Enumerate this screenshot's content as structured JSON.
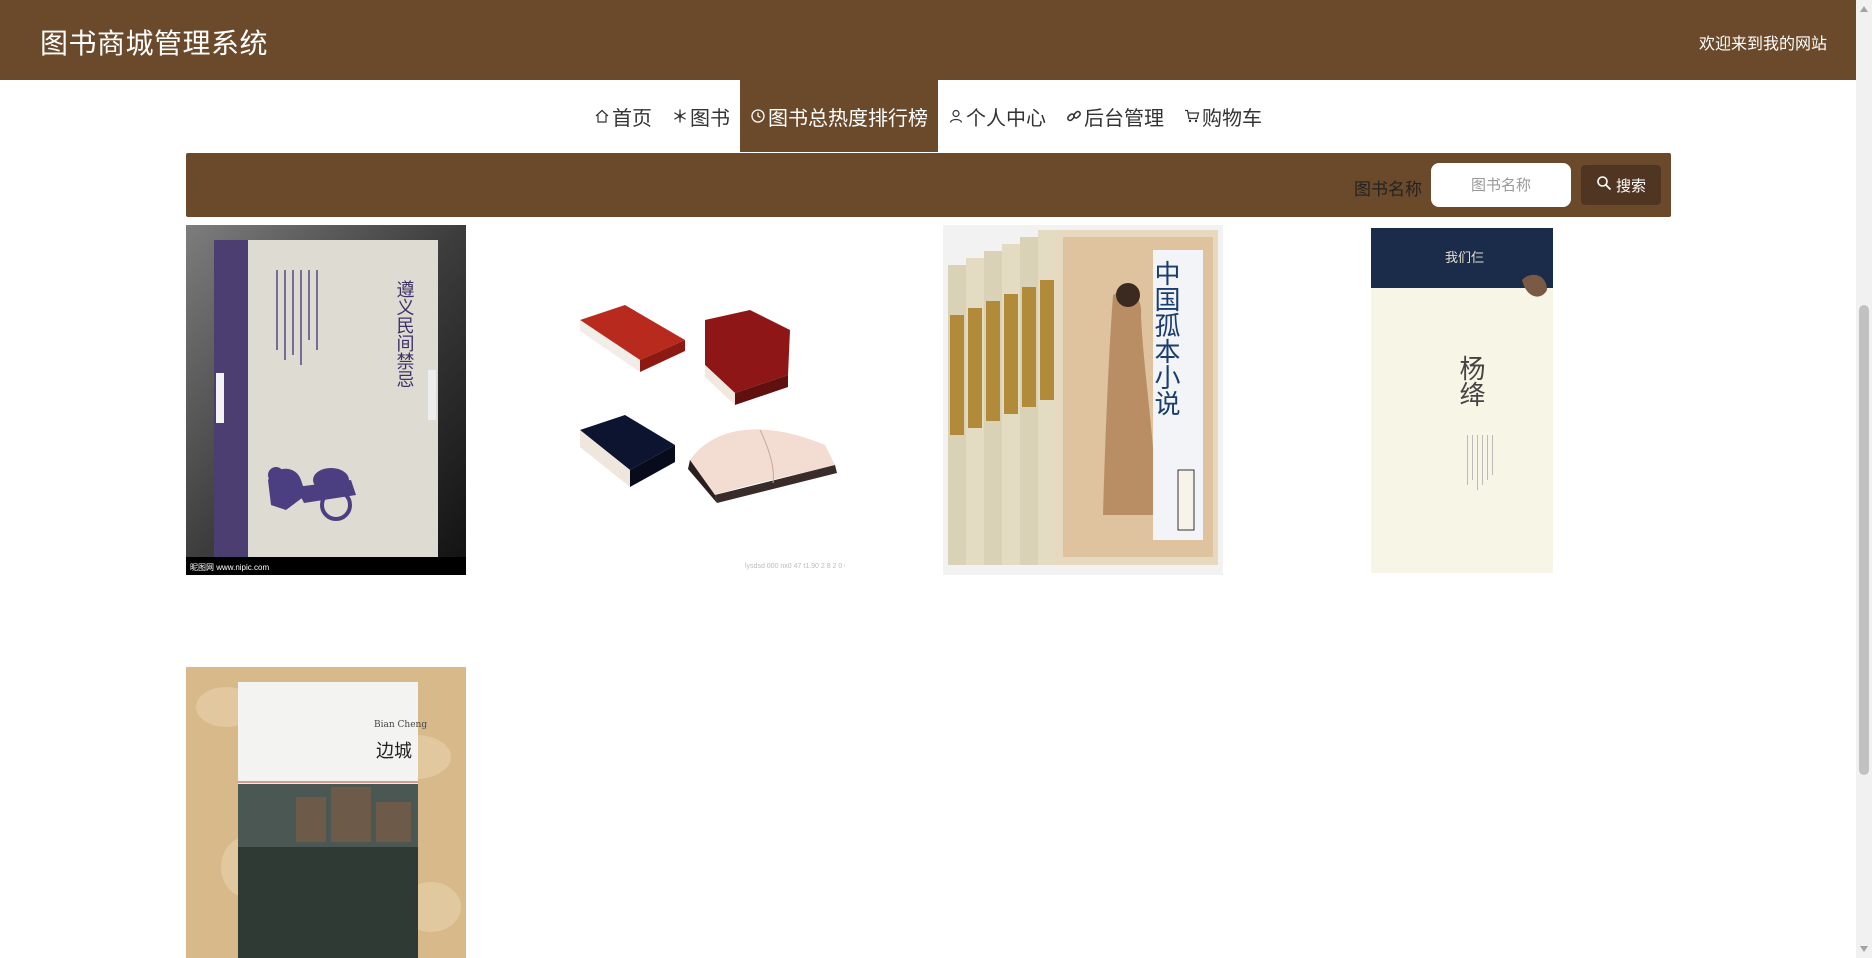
{
  "header": {
    "title": "图书商城管理系统",
    "welcome": "欢迎来到我的网站"
  },
  "nav": {
    "items": [
      {
        "label": "首页",
        "icon": "home-icon"
      },
      {
        "label": "图书",
        "icon": "snowflake-icon"
      },
      {
        "label": "图书总热度排行榜",
        "icon": "clock-icon",
        "active": true
      },
      {
        "label": "个人中心",
        "icon": "user-icon"
      },
      {
        "label": "后台管理",
        "icon": "link-icon"
      },
      {
        "label": "购物车",
        "icon": "cart-icon"
      }
    ]
  },
  "search": {
    "label": "图书名称",
    "placeholder": "图书名称",
    "button_label": "搜索",
    "button_icon": "search-icon"
  },
  "books": [
    {
      "cover_title": "遵义民间禁忌",
      "watermark_left": "昵图网 www.nipic.com"
    },
    {
      "cover_title": "",
      "watermark_left": ""
    },
    {
      "cover_title": "中国孤本小说",
      "watermark_left": ""
    },
    {
      "cover_title": "杨绛",
      "top_label": "我们仨",
      "watermark_left": ""
    },
    {
      "cover_title": "边城",
      "top_label": "Bian Cheng",
      "watermark_left": ""
    }
  ],
  "colors": {
    "brand": "#6b4a2b",
    "button": "#503622"
  }
}
